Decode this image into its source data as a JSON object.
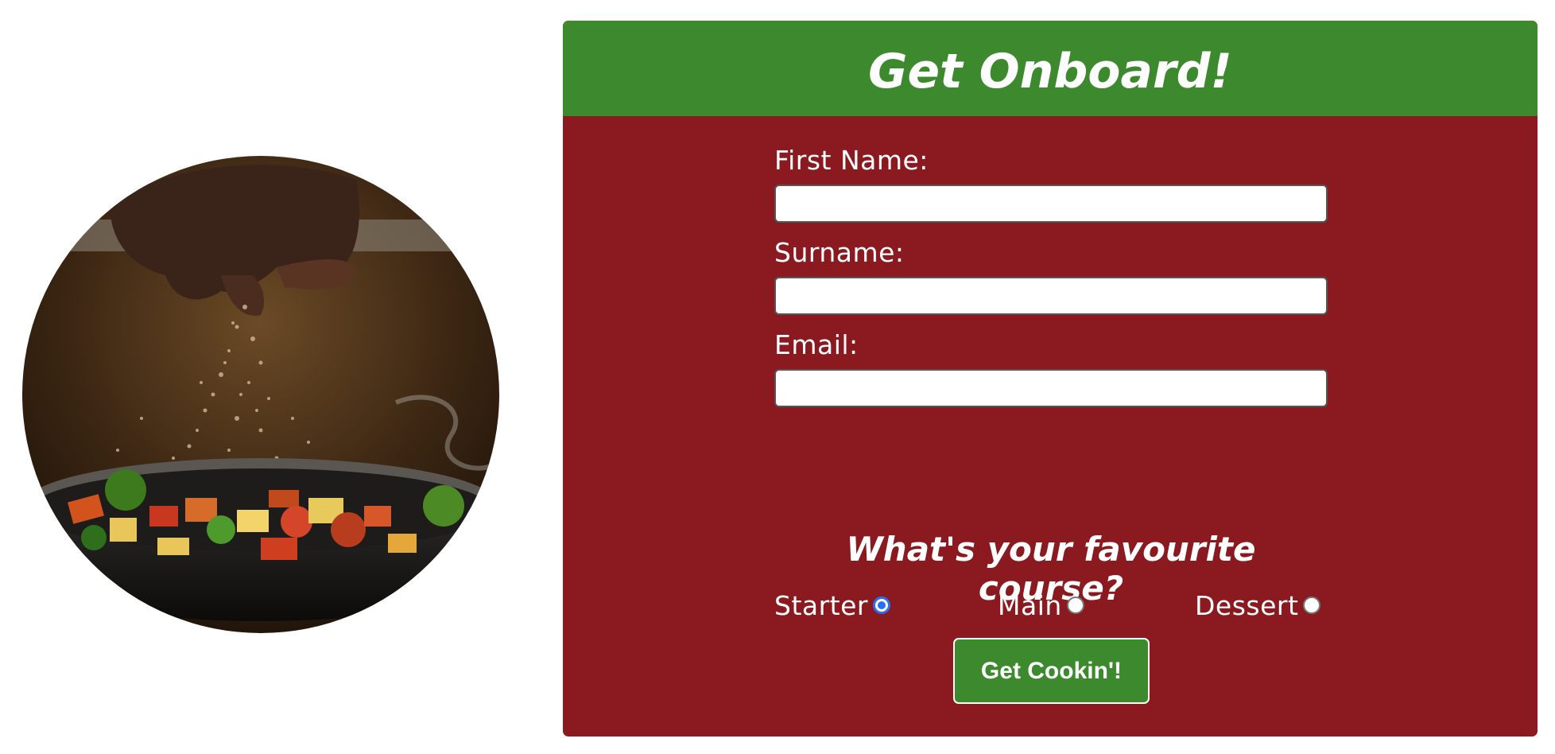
{
  "colors": {
    "header_green": "#3d8a2e",
    "form_red": "#8a1a20",
    "radio_selected": "#2a6ff0",
    "text_white": "#ffffff"
  },
  "hero_image": {
    "alt": "",
    "icon": "cooking-pan-photo"
  },
  "form": {
    "title": "Get Onboard!",
    "fields": [
      {
        "label": "First Name:",
        "value": "",
        "placeholder": ""
      },
      {
        "label": "Surname:",
        "value": "",
        "placeholder": ""
      },
      {
        "label": "Email:",
        "value": "",
        "placeholder": ""
      }
    ],
    "course_question": "What's your favourite course?",
    "course_options": [
      {
        "label": "Starter",
        "selected": true
      },
      {
        "label": "Main",
        "selected": false
      },
      {
        "label": "Dessert",
        "selected": false
      }
    ],
    "submit_label": "Get Cookin'!"
  }
}
